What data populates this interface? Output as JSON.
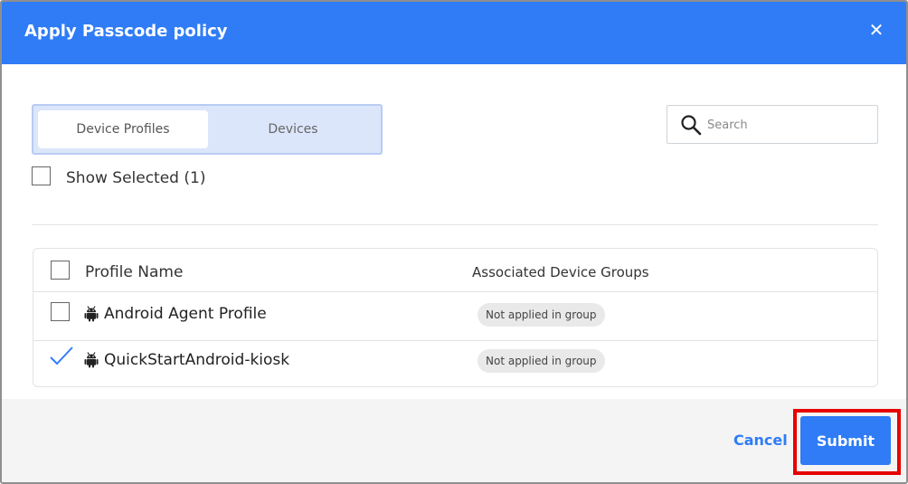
{
  "dialog": {
    "title": "Apply Passcode policy",
    "close_icon": "close-icon"
  },
  "tabs": [
    {
      "label": "Device Profiles",
      "active": true
    },
    {
      "label": "Devices",
      "active": false
    }
  ],
  "search": {
    "placeholder": "Search",
    "value": "",
    "icon": "search-icon"
  },
  "filter": {
    "show_selected_label": "Show Selected (1)",
    "checked": false
  },
  "table": {
    "columns": [
      "Profile Name",
      "Associated Device Groups"
    ],
    "rows": [
      {
        "name": "Android Agent Profile",
        "icon": "android-icon",
        "group_status": "Not applied in group",
        "selected": false
      },
      {
        "name": "QuickStartAndroid-kiosk",
        "icon": "android-icon",
        "group_status": "Not applied in group",
        "selected": true
      }
    ]
  },
  "footer": {
    "cancel_label": "Cancel",
    "submit_label": "Submit"
  },
  "colors": {
    "accent": "#2f7cf6",
    "highlight": "#e60000"
  }
}
